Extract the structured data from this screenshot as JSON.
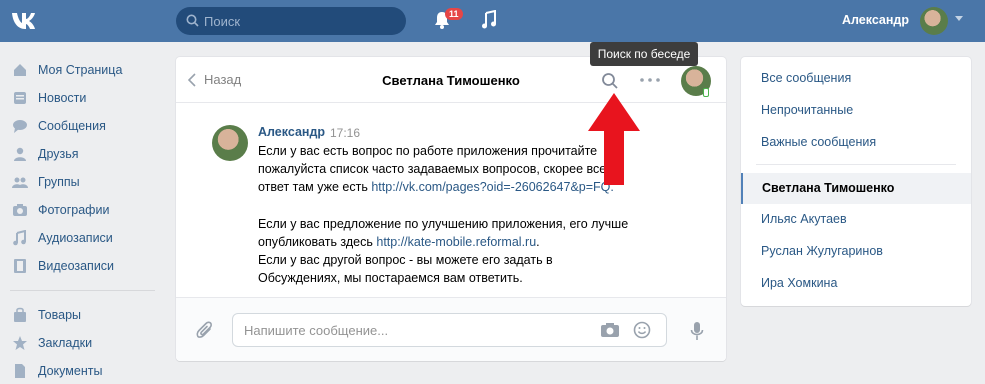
{
  "topbar": {
    "logo": "vk-logo-icon",
    "search_placeholder": "Поиск",
    "notifications_count": "11",
    "user_name": "Александр"
  },
  "nav": {
    "items": [
      {
        "label": "Моя Страница",
        "icon": "user-home-icon"
      },
      {
        "label": "Новости",
        "icon": "news-icon"
      },
      {
        "label": "Сообщения",
        "icon": "chat-icon"
      },
      {
        "label": "Друзья",
        "icon": "person-icon"
      },
      {
        "label": "Группы",
        "icon": "group-icon"
      },
      {
        "label": "Фотографии",
        "icon": "camera-icon"
      },
      {
        "label": "Аудиозаписи",
        "icon": "music-icon"
      },
      {
        "label": "Видеозаписи",
        "icon": "film-icon"
      }
    ],
    "items2": [
      {
        "label": "Товары",
        "icon": "bag-icon"
      },
      {
        "label": "Закладки",
        "icon": "star-icon"
      },
      {
        "label": "Документы",
        "icon": "document-icon"
      }
    ]
  },
  "chat": {
    "back_label": "Назад",
    "title": "Светлана Тимошенко",
    "tooltip": "Поиск по беседе",
    "message": {
      "author": "Александр",
      "time": "17:16",
      "lines": [
        "Если у вас есть вопрос по работе приложения прочитайте",
        "пожалуйста список часто задаваемых вопросов, скорее всего",
        "ответ там уже есть ",
        "",
        "Если у вас предложение по улучшению приложения, его лучше",
        "опубликовать здесь ",
        "Если у вас другой вопрос - вы можете его задать в",
        "Обсуждениях, мы постараемся вам ответить."
      ],
      "link1": "http://vk.com/pages?oid=-26062647&p=F",
      "link1_end": "Q.",
      "link2": "http://kate-mobile.reformal.ru",
      "link2_end": "."
    },
    "compose_placeholder": "Напишите сообщение..."
  },
  "right": {
    "items": [
      "Все сообщения",
      "Непрочитанные",
      "Важные сообщения"
    ],
    "active_dialog": "Светлана Тимошенко",
    "dialogs": [
      "Ильяс Акутаев",
      "Руслан Жулугаринов",
      "Ира Хомкина"
    ]
  },
  "colors": {
    "topbar": "#4a76a8",
    "link": "#2a5885",
    "arrow": "#e8141e"
  }
}
